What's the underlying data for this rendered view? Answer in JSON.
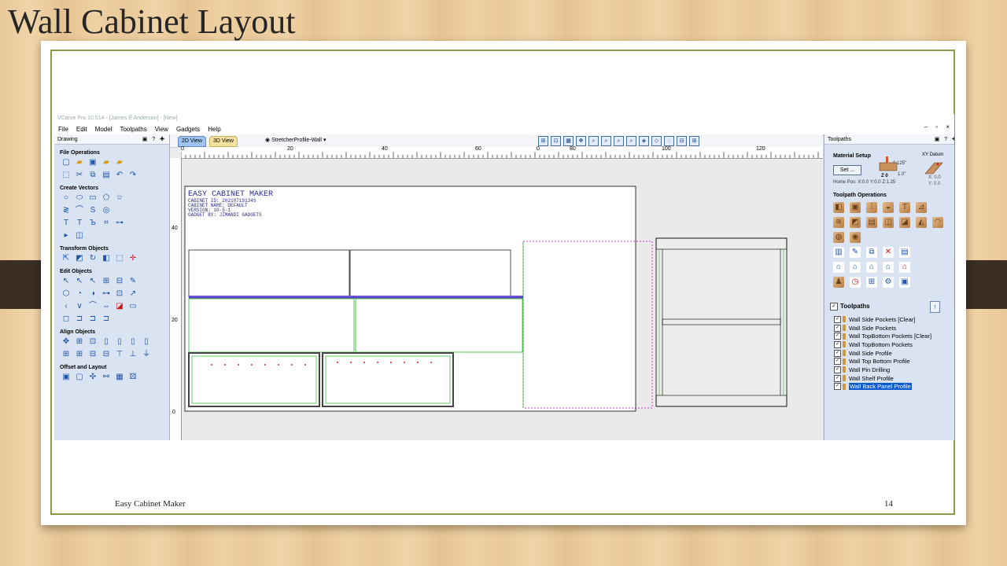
{
  "slide": {
    "title": "Wall Cabinet Layout",
    "footer_left": "Easy Cabinet Maker",
    "page_number": "14"
  },
  "app": {
    "title_text": "VCarve Pro 10.514 - [James E Anderson] - [New]",
    "menu": [
      "File",
      "Edit",
      "Model",
      "Toolpaths",
      "View",
      "Gadgets",
      "Help"
    ],
    "left_panel": {
      "title": "Drawing",
      "sections": [
        "File Operations",
        "Create Vectors",
        "Transform Objects",
        "Edit Objects",
        "Align Objects",
        "Offset and Layout"
      ]
    },
    "tabs": [
      "2D View",
      "3D View"
    ],
    "profile_select": "StretcherProfile-Wall",
    "ruler_x": [
      "0",
      "20",
      "40",
      "60",
      "80",
      "100",
      "120",
      "0"
    ],
    "ruler_y": [
      "40",
      "20",
      "0"
    ],
    "canvas_text": {
      "header": [
        "EASY CABINET MAKER",
        "CABINET ID: 20210719134S",
        "CABINET NAME: DEFAULT",
        "VERSION: 10-5-1",
        "GADGET BY: JIMANDI GADGETS"
      ]
    },
    "right_panel": {
      "title": "Toolpaths",
      "material_setup": "Material Setup",
      "set_button": "Set ...",
      "thickness_top": "0.125\"",
      "thickness_mid": "1.0\"",
      "z0": "Z 0",
      "xy_datum": "XY Datum",
      "xy_x": "X: 0.0",
      "xy_y": "Y: 0.0",
      "home_pos": "Home Pos:  X:0.0 Y:0.0 Z:1.25",
      "operations_title": "Toolpath Operations",
      "list_title": "Toolpaths",
      "toolpaths": [
        "Wall Side Pockets [Clear]",
        "Wall Side Pockets",
        "Wall TopBottom Pockets [Clear]",
        "Wall TopBottom Pockets",
        "Wall Side Profile",
        "Wall Top Bottom Profile",
        "Wall Pin Drilling",
        "Wall Shelf Profile",
        "Wall Back Panel Profile"
      ],
      "selected_index": 8
    }
  },
  "colors": {
    "vector_green": "#00c000",
    "vector_magenta": "#c000c0",
    "vector_purple": "#7a5ccc",
    "selection_blue": "#0b5bd3"
  }
}
